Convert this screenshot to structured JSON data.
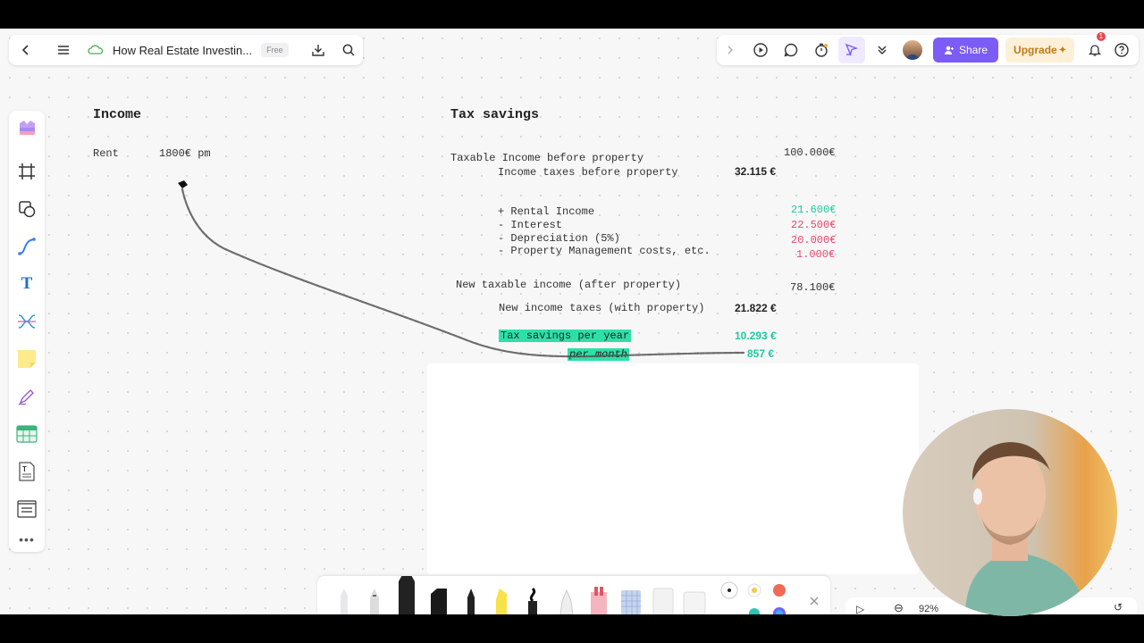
{
  "app": {
    "doc_title": "How Real Estate Investin...",
    "plan_badge": "Free",
    "share_label": "Share",
    "upgrade_label": "Upgrade",
    "notification_count": "1",
    "zoom_level": "92%"
  },
  "icons": {
    "top_left": [
      "back-icon",
      "menu-icon",
      "cloud-sync-icon",
      "download-icon",
      "search-icon"
    ],
    "top_right": [
      "chevron-right-icon",
      "present-icon",
      "comment-icon",
      "timer-icon",
      "pointer-follow-icon",
      "more-chevron-icon",
      "avatar",
      "bell-icon",
      "help-icon"
    ],
    "left_toolbar": [
      "templates-icon",
      "frame-icon",
      "shape-icon",
      "connector-icon",
      "text-icon",
      "mindmap-icon",
      "sticky-note-icon",
      "pen-icon",
      "table-icon",
      "document-icon",
      "list-icon",
      "more-icon"
    ]
  },
  "board": {
    "income": {
      "heading": "Income",
      "rent_label": "Rent",
      "rent_value": "1800€ pm"
    },
    "tax": {
      "heading": "Tax savings",
      "taxable_before_label": "Taxable Income before property",
      "taxable_before_value": "100.000€",
      "income_taxes_before_label": "Income taxes before property",
      "income_taxes_before_value": "32.115 €",
      "rental_income_label": "+ Rental Income",
      "rental_income_value": "21.600€",
      "interest_label": "- Interest",
      "interest_value": "22.500€",
      "depreciation_label": "- Depreciation (5%)",
      "depreciation_value": "20.000€",
      "management_label": "- Property Management costs, etc.",
      "management_value": "1.000€",
      "new_taxable_label": "New taxable income (after property)",
      "new_taxable_value": "78.100€",
      "new_taxes_label": "New income taxes (with property)",
      "new_taxes_value": "21.822 €",
      "savings_year_label": "Tax savings per year",
      "savings_year_value": "10.293 €",
      "savings_month_label": "per month",
      "savings_month_value": "857 €"
    }
  },
  "colors": {
    "accent_purple": "#7b5cf5",
    "teal": "#1fcaa0",
    "red": "#e8486f",
    "highlight": "#2ee0a8"
  }
}
